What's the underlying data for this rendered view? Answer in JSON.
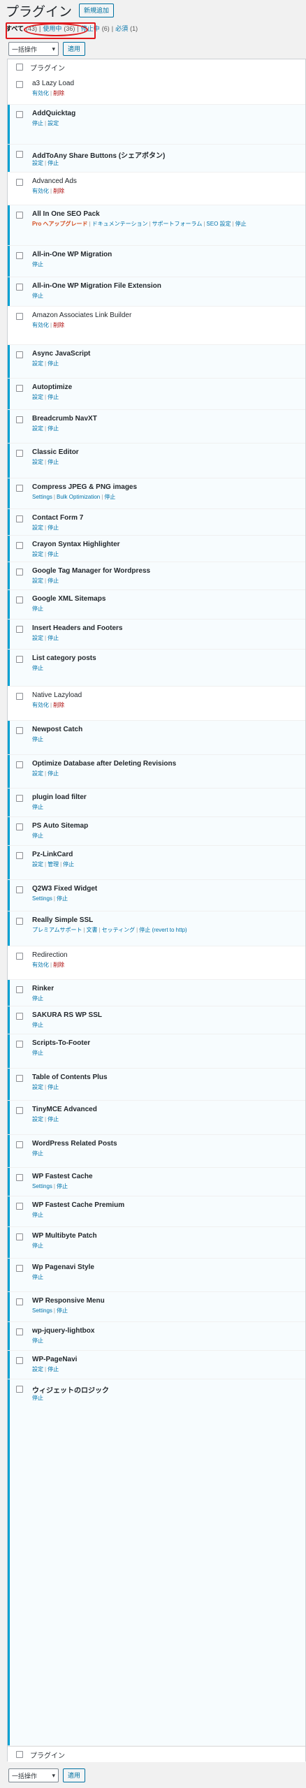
{
  "header": {
    "title": "プラグイン",
    "add_new": "新規追加"
  },
  "filters": [
    {
      "label": "すべて",
      "count": "(43)",
      "current": true
    },
    {
      "label": "使用中",
      "count": "(36)",
      "current": false
    },
    {
      "label": "停止中",
      "count": "(6)",
      "current": false
    },
    {
      "label": "必須",
      "count": "(1)",
      "current": false
    }
  ],
  "bulk": {
    "select": "一括操作",
    "apply": "適用"
  },
  "table": {
    "column": "プラグイン"
  },
  "plugins": [
    {
      "name": "a3 Lazy Load",
      "active": false,
      "actions": [
        "有効化",
        "削除"
      ]
    },
    {
      "name": "AddQuicktag",
      "active": true,
      "actions": [
        "停止",
        "設定"
      ]
    },
    {
      "name": "AddToAny Share Buttons (シェアボタン)",
      "active": true,
      "actions": [
        "設定",
        "停止"
      ]
    },
    {
      "name": "Advanced Ads",
      "active": false,
      "actions": [
        "有効化",
        "削除"
      ]
    },
    {
      "name": "All In One SEO Pack",
      "active": true,
      "actions": [
        "Pro へアップグレード",
        "ドキュメンテーション",
        "サポートフォーラム",
        "SEO 設定",
        "停止"
      ]
    },
    {
      "name": "All-in-One WP Migration",
      "active": true,
      "actions": [
        "停止"
      ]
    },
    {
      "name": "All-in-One WP Migration File Extension",
      "active": true,
      "actions": [
        "停止"
      ]
    },
    {
      "name": "Amazon Associates Link Builder",
      "active": false,
      "actions": [
        "有効化",
        "削除"
      ]
    },
    {
      "name": "Async JavaScript",
      "active": true,
      "actions": [
        "設定",
        "停止"
      ]
    },
    {
      "name": "Autoptimize",
      "active": true,
      "actions": [
        "設定",
        "停止"
      ]
    },
    {
      "name": "Breadcrumb NavXT",
      "active": true,
      "actions": [
        "設定",
        "停止"
      ]
    },
    {
      "name": "Classic Editor",
      "active": true,
      "actions": [
        "設定",
        "停止"
      ]
    },
    {
      "name": "Compress JPEG & PNG images",
      "active": true,
      "actions": [
        "Settings",
        "Bulk Optimization",
        "停止"
      ]
    },
    {
      "name": "Contact Form 7",
      "active": true,
      "actions": [
        "設定",
        "停止"
      ]
    },
    {
      "name": "Crayon Syntax Highlighter",
      "active": true,
      "actions": [
        "設定",
        "停止"
      ]
    },
    {
      "name": "Google Tag Manager for Wordpress",
      "active": true,
      "actions": [
        "設定",
        "停止"
      ]
    },
    {
      "name": "Google XML Sitemaps",
      "active": true,
      "actions": [
        "停止"
      ]
    },
    {
      "name": "Insert Headers and Footers",
      "active": true,
      "actions": [
        "設定",
        "停止"
      ]
    },
    {
      "name": "List category posts",
      "active": true,
      "actions": [
        "停止"
      ]
    },
    {
      "name": "Native Lazyload",
      "active": false,
      "actions": [
        "有効化",
        "削除"
      ]
    },
    {
      "name": "Newpost Catch",
      "active": true,
      "actions": [
        "停止"
      ]
    },
    {
      "name": "Optimize Database after Deleting Revisions",
      "active": true,
      "actions": [
        "設定",
        "停止"
      ]
    },
    {
      "name": "plugin load filter",
      "active": true,
      "actions": [
        "停止"
      ]
    },
    {
      "name": "PS Auto Sitemap",
      "active": true,
      "actions": [
        "停止"
      ]
    },
    {
      "name": "Pz-LinkCard",
      "active": true,
      "actions": [
        "設定",
        "管理",
        "停止"
      ]
    },
    {
      "name": "Q2W3 Fixed Widget",
      "active": true,
      "actions": [
        "Settings",
        "停止"
      ]
    },
    {
      "name": "Really Simple SSL",
      "active": true,
      "actions": [
        "プレミアムサポート",
        "文書",
        "セッティング",
        "停止 (revert to http)"
      ]
    },
    {
      "name": "Redirection",
      "active": false,
      "actions": [
        "有効化",
        "削除"
      ]
    },
    {
      "name": "Rinker",
      "active": true,
      "actions": [
        "停止"
      ]
    },
    {
      "name": "SAKURA RS WP SSL",
      "active": true,
      "actions": [
        "停止"
      ]
    },
    {
      "name": "Scripts-To-Footer",
      "active": true,
      "actions": [
        "停止"
      ]
    },
    {
      "name": "Table of Contents Plus",
      "active": true,
      "actions": [
        "設定",
        "停止"
      ]
    },
    {
      "name": "TinyMCE Advanced",
      "active": true,
      "actions": [
        "設定",
        "停止"
      ]
    },
    {
      "name": "WordPress Related Posts",
      "active": true,
      "actions": [
        "停止"
      ]
    },
    {
      "name": "WP Fastest Cache",
      "active": true,
      "actions": [
        "Settings",
        "停止"
      ]
    },
    {
      "name": "WP Fastest Cache Premium",
      "active": true,
      "actions": [
        "停止"
      ]
    },
    {
      "name": "WP Multibyte Patch",
      "active": true,
      "actions": [
        "停止"
      ]
    },
    {
      "name": "Wp Pagenavi Style",
      "active": true,
      "actions": [
        "停止"
      ]
    },
    {
      "name": "WP Responsive Menu",
      "active": true,
      "actions": [
        "Settings",
        "停止"
      ]
    },
    {
      "name": "wp-jquery-lightbox",
      "active": true,
      "actions": [
        "停止"
      ]
    },
    {
      "name": "WP-PageNavi",
      "active": true,
      "actions": [
        "設定",
        "停止"
      ]
    },
    {
      "name": "ウィジェットのロジック",
      "active": true,
      "actions": [
        "停止"
      ]
    }
  ],
  "colors": {
    "active_bar": "#00a0d2",
    "link": "#0073aa",
    "delete": "#a00",
    "annotation": "#e0191c"
  }
}
